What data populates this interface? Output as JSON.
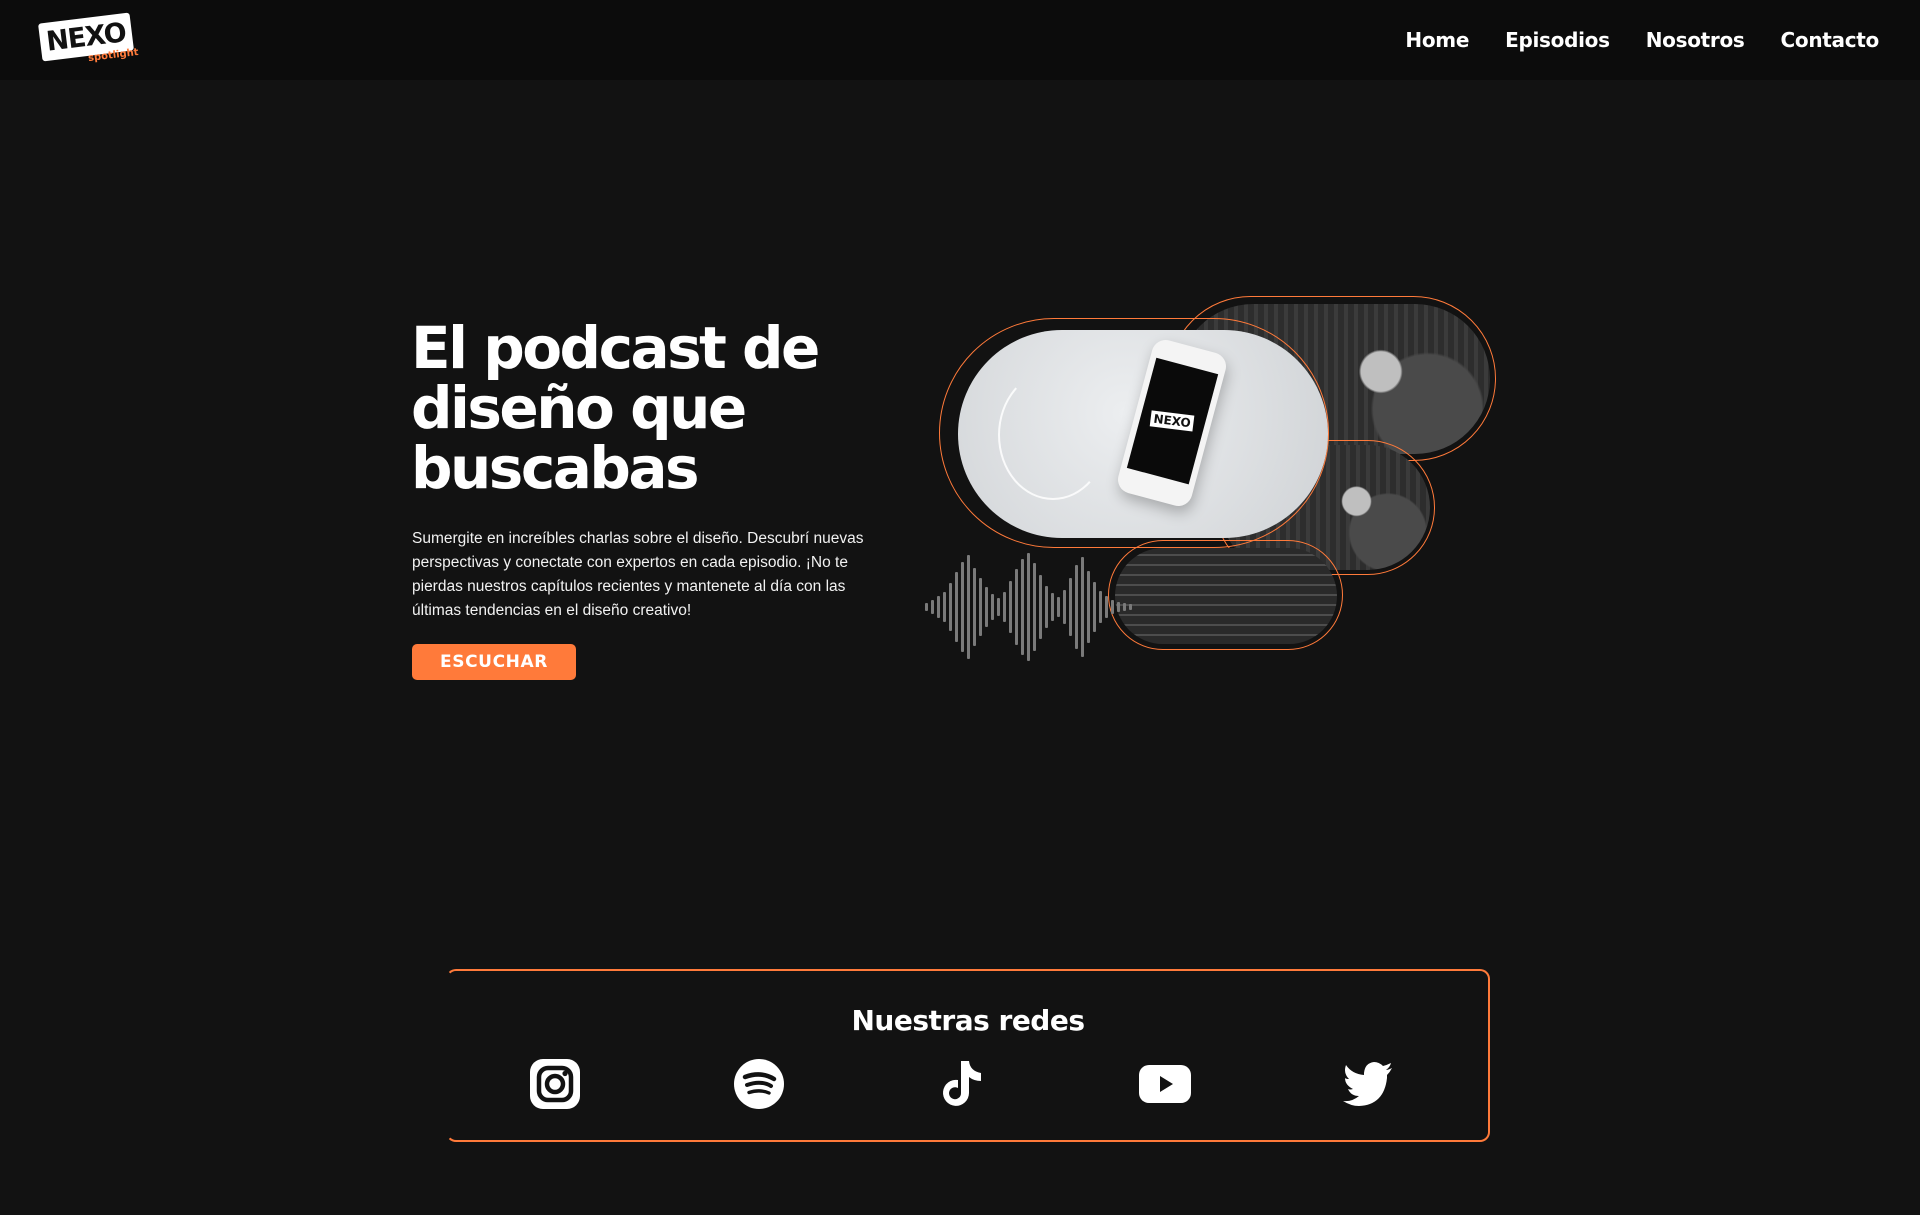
{
  "nav": {
    "logo_text": "NEXO",
    "logo_tag": "spotlight",
    "items": [
      {
        "label": "Home"
      },
      {
        "label": "Episodios"
      },
      {
        "label": "Nosotros"
      },
      {
        "label": "Contacto"
      }
    ]
  },
  "hero": {
    "title_lines": [
      "El podcast de",
      "diseño que",
      "buscabas"
    ],
    "description": "Sumergite en increíbles charlas sobre el diseño. Descubrí nuevas perspectivas y conectate con expertos en cada episodio. ¡No te pierdas nuestros capítulos recientes y mantenete al día con las últimas tendencias en el diseño creativo!",
    "cta_label": "ESCUCHAR",
    "phone_logo": "NEXO"
  },
  "social": {
    "title": "Nuestras redes",
    "icons": [
      "instagram-icon",
      "spotify-icon",
      "tiktok-icon",
      "youtube-icon",
      "twitter-icon"
    ]
  },
  "colors": {
    "background": "#121212",
    "nav": "#0c0c0c",
    "accent": "#ff7a3a",
    "text": "#ffffff"
  }
}
